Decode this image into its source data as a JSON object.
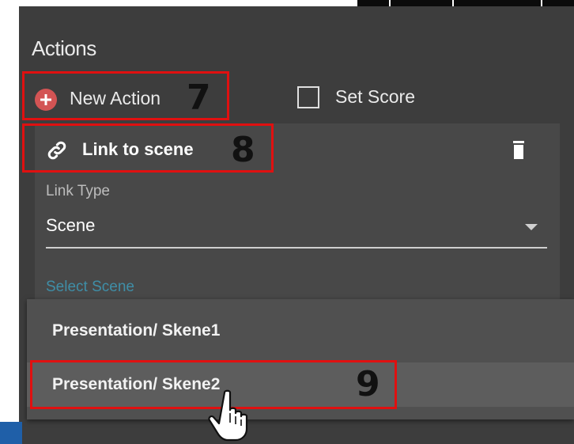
{
  "actions": {
    "heading": "Actions",
    "new_action_label": "New Action",
    "set_score_label": "Set Score",
    "set_score_checked": false
  },
  "link_card": {
    "title": "Link to scene",
    "link_type_label": "Link Type",
    "link_type_value": "Scene",
    "select_scene_label": "Select Scene"
  },
  "dropdown": {
    "options": [
      "Presentation/ Skene1",
      "Presentation/ Skene2"
    ],
    "highlighted_index": 1
  },
  "annotations": [
    "7",
    "8",
    "9"
  ],
  "colors": {
    "panel_bg": "#3d3d3d",
    "card_bg": "#484848",
    "accent_add": "#d35454",
    "select_label": "#3f8ea7",
    "annotation_box": "#e01010"
  },
  "icons": [
    "plus-circle-icon",
    "checkbox-icon",
    "link-icon",
    "trash-icon",
    "dropdown-caret-icon",
    "hand-cursor-icon"
  ]
}
